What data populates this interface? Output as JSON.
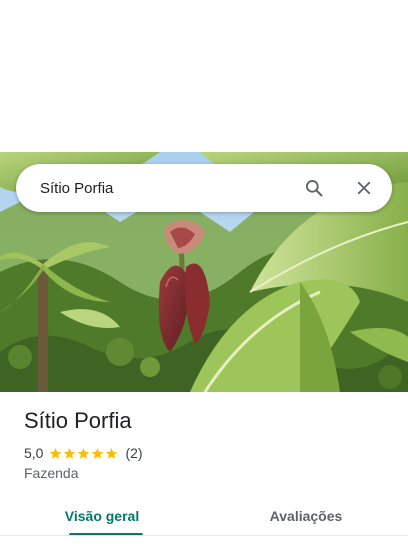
{
  "search": {
    "value": "Sítio Porfia"
  },
  "place": {
    "title": "Sítio Porfia",
    "rating": "5,0",
    "stars": 5,
    "review_count": "(2)",
    "category": "Fazenda"
  },
  "tabs": [
    {
      "label": "Visão geral",
      "active": true
    },
    {
      "label": "Avaliações",
      "active": false
    }
  ],
  "colors": {
    "accent": "#00796b",
    "star": "#fbbc04"
  },
  "icons": {
    "search": "search-icon",
    "close": "close-icon",
    "star": "star-icon"
  }
}
